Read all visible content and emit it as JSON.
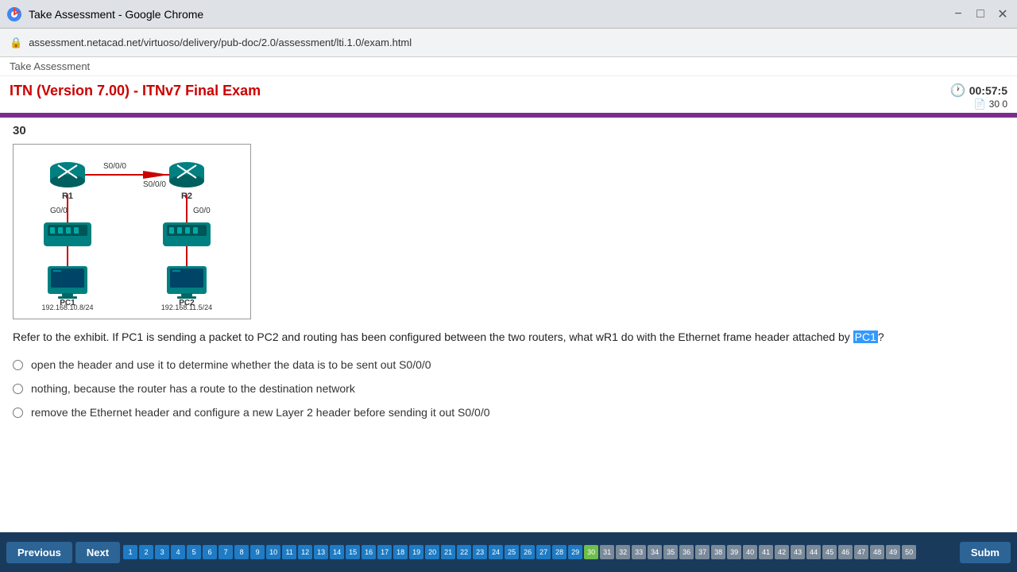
{
  "browser": {
    "title": "Take Assessment - Google Chrome",
    "url": "assessment.netacad.net/virtuoso/delivery/pub-doc/2.0/assessment/lti.1.0/exam.html",
    "minimize_label": "−",
    "maximize_label": "□"
  },
  "breadcrumb": "Take Assessment",
  "header": {
    "title": "ITN (Version 7.00) - ITNv7 Final Exam",
    "timer_label": "00:57:5",
    "timer_sublabel": "30 0"
  },
  "question": {
    "number": "30",
    "text_before": "Refer to the exhibit. If PC1 is sending a packet to PC2 and routing has been configured between the two routers, what w",
    "text_r1": "R1",
    "text_after": " do with the Ethernet frame header attached by ",
    "highlight": "PC1",
    "text_end": "?"
  },
  "answers": [
    {
      "id": "a1",
      "text": "open the header and use it to determine whether the data is to be sent out S0/0/0"
    },
    {
      "id": "a2",
      "text": "nothing, because the router has a route to the destination network"
    },
    {
      "id": "a3",
      "text": "remove the Ethernet header and configure a new Layer 2 header before sending it out S0/0/0"
    }
  ],
  "navigation": {
    "previous_label": "Previous",
    "next_label": "Next",
    "submit_label": "Subm",
    "answered_count": 28,
    "current_question": 30,
    "total_questions": 50
  },
  "diagram": {
    "r1_label": "R1",
    "r2_label": "R2",
    "pc1_label": "PC1",
    "pc2_label": "PC2",
    "s00_top": "S0/0/0",
    "s00_bot": "S0/0/0",
    "g00_left": "G0/0",
    "g00_right": "G0/0",
    "network1": "192.168.10.8/24",
    "network2": "192.168.11.5/24"
  }
}
